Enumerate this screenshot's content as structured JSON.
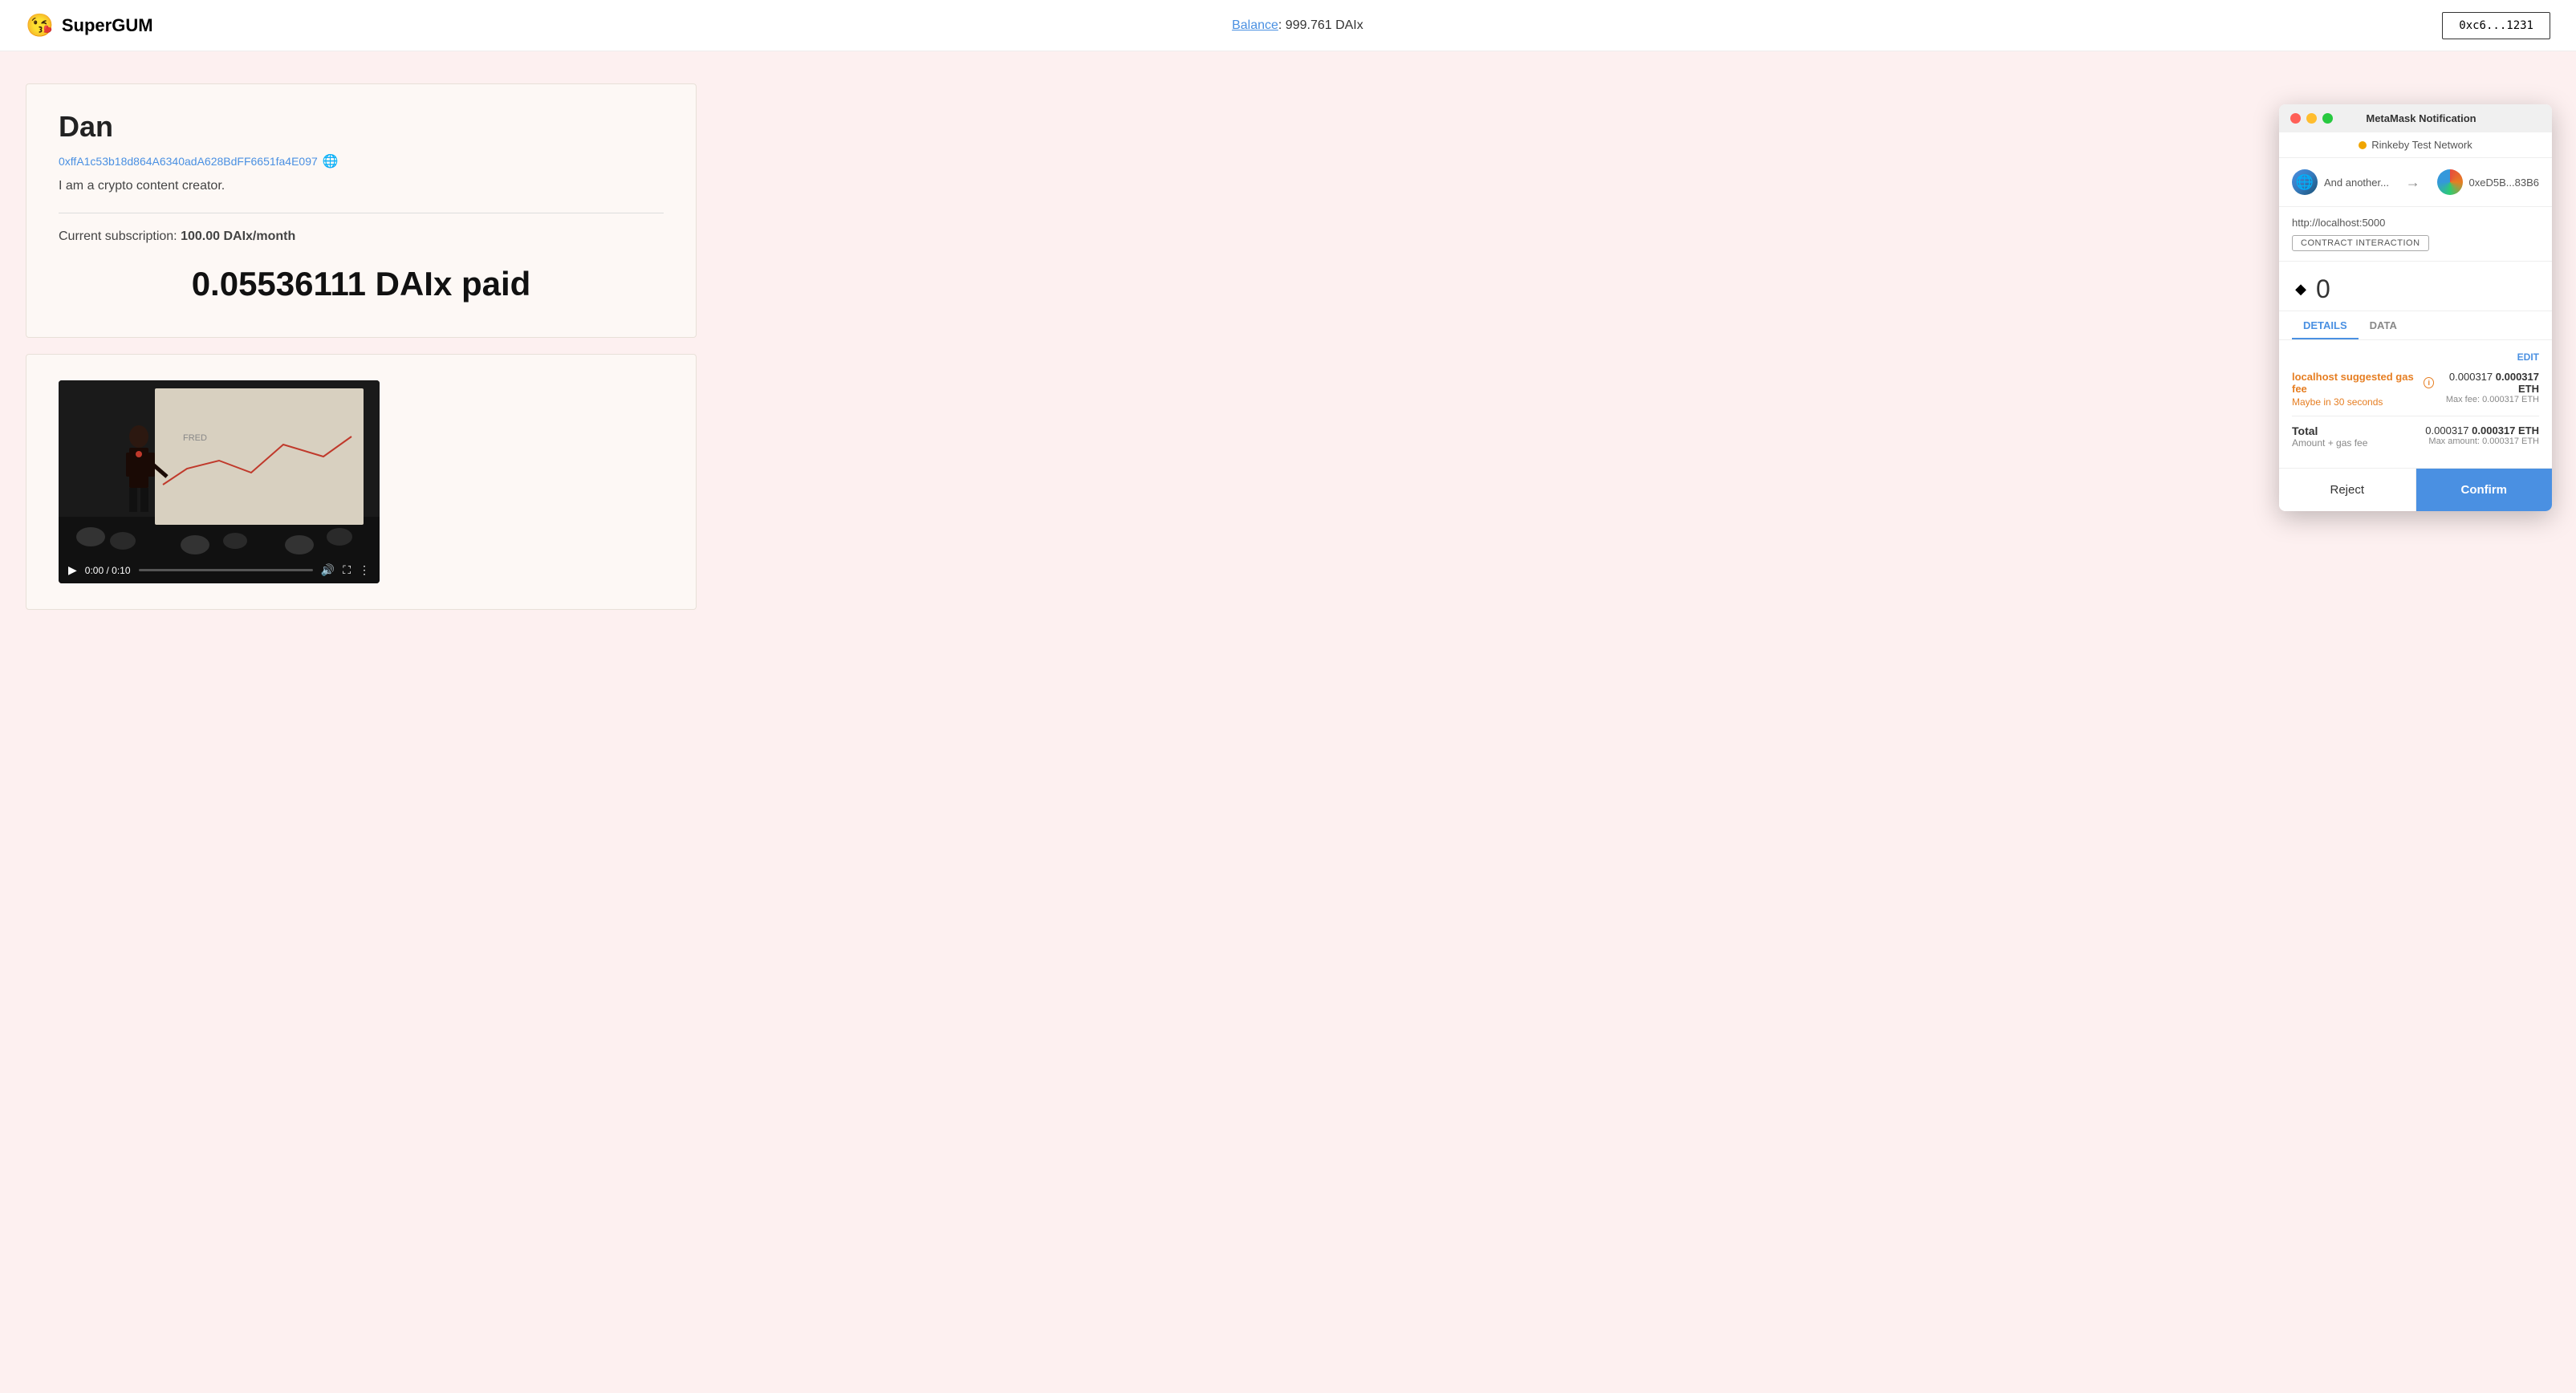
{
  "header": {
    "logo_emoji": "😘",
    "logo_text": "SuperGUM",
    "balance_label": "Balance",
    "balance_value": "999.761 DAIx",
    "wallet_address": "0xc6...1231"
  },
  "profile": {
    "name": "Dan",
    "address": "0xffA1c53b18d864A6340adA628BdFF6651fa4E097",
    "bio": "I am a crypto content creator.",
    "subscription_label": "Current subscription:",
    "subscription_value": "100.00 DAIx/month",
    "paid_amount": "0.05536111 DAIx paid"
  },
  "video": {
    "time_current": "0:00",
    "time_total": "0:10"
  },
  "metamask": {
    "title": "MetaMask Notification",
    "network": "Rinkeby Test Network",
    "from_label": "And another...",
    "to_address": "0xeD5B...83B6",
    "url": "http://localhost:5000",
    "contract_badge": "CONTRACT INTERACTION",
    "eth_amount": "0",
    "tab_details": "DETAILS",
    "tab_data": "DATA",
    "edit_label": "EDIT",
    "gas_label": "localhost suggested gas fee",
    "gas_value": "0.000317",
    "gas_bold": "0.000317 ETH",
    "gas_maybe": "Maybe in 30 seconds",
    "max_fee_label": "Max fee:",
    "max_fee_value": "0.000317 ETH",
    "total_label": "Total",
    "total_sublabel": "Amount + gas fee",
    "total_value": "0.000317",
    "total_bold": "0.000317 ETH",
    "max_amount_label": "Max amount:",
    "max_amount_value": "0.000317 ETH",
    "reject_label": "Reject",
    "confirm_label": "Confirm"
  }
}
